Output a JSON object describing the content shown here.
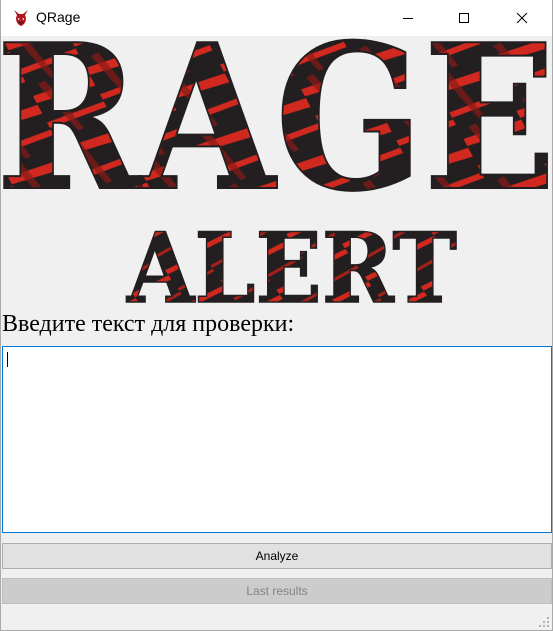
{
  "window": {
    "title": "QRage",
    "icons": {
      "app": "devil-head-icon",
      "minimize": "minimize-icon",
      "maximize": "maximize-icon",
      "close": "close-icon"
    }
  },
  "banner": {
    "line1": "RAGE",
    "line2": "ALERT",
    "colors": {
      "dark": "#231f20",
      "red": "#d1281f",
      "background": "#f0f0f0"
    }
  },
  "main": {
    "prompt": "Введите текст для проверки:",
    "input_value": ""
  },
  "actions": {
    "analyze_label": "Analyze",
    "last_results_label": "Last results"
  },
  "colors": {
    "focus_border": "#0078d7",
    "button_face": "#e1e1e1",
    "disabled_text": "#838383"
  }
}
